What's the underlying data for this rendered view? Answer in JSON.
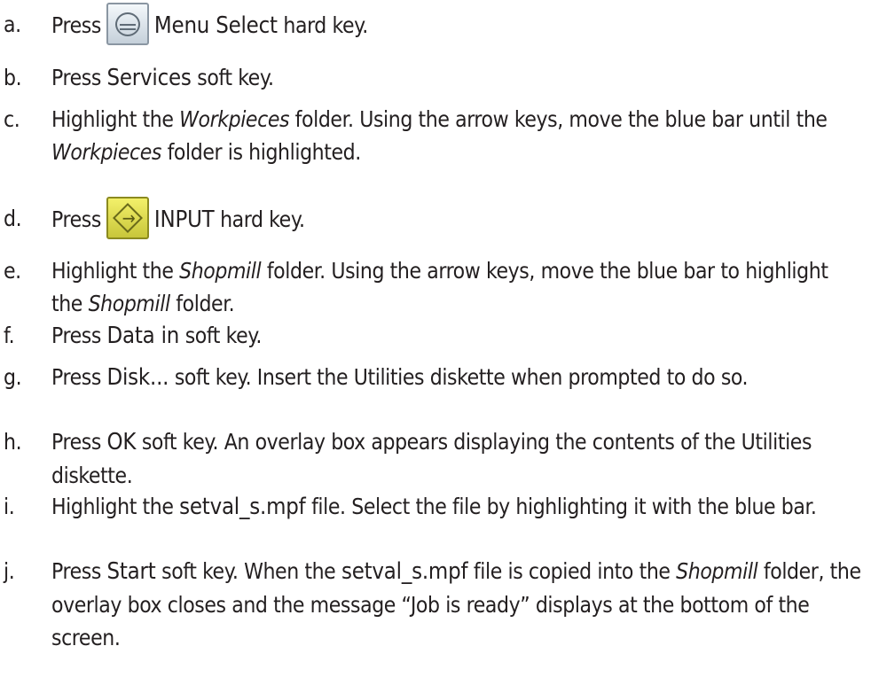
{
  "steps": [
    {
      "marker": "a.",
      "parts": [
        {
          "t": "Press"
        },
        {
          "key": "menu-select",
          "icon": "menu-select-key-icon"
        },
        {
          "t": "Menu Select",
          "s": "kw"
        },
        {
          "t": " hard key."
        }
      ]
    },
    {
      "marker": "b.",
      "parts": [
        {
          "t": "Press "
        },
        {
          "t": "Services",
          "s": "kw"
        },
        {
          "t": " soft key."
        }
      ]
    },
    {
      "marker": "c.",
      "parts": [
        {
          "t": "Highlight the "
        },
        {
          "t": "Workpieces",
          "s": "it"
        },
        {
          "t": " folder. Using the arrow keys, move the blue bar until the "
        },
        {
          "t": "Workpieces",
          "s": "it"
        },
        {
          "t": " folder is highlighted."
        }
      ]
    },
    {
      "marker": "d.",
      "parts": [
        {
          "t": "Press"
        },
        {
          "key": "input",
          "icon": "input-key-icon"
        },
        {
          "t": "INPUT",
          "s": "kw"
        },
        {
          "t": " hard key."
        }
      ]
    },
    {
      "marker": "e.",
      "parts": [
        {
          "t": "Highlight the "
        },
        {
          "t": "Shopmill",
          "s": "it"
        },
        {
          "t": " folder. Using the arrow keys, move the blue bar to highlight the "
        },
        {
          "t": "Shopmill",
          "s": "it"
        },
        {
          "t": " folder."
        }
      ]
    },
    {
      "marker": "f.",
      "parts": [
        {
          "t": "Press "
        },
        {
          "t": "Data in",
          "s": "kw"
        },
        {
          "t": " soft key."
        }
      ]
    },
    {
      "marker": "g.",
      "parts": [
        {
          "t": "Press "
        },
        {
          "t": "Disk...",
          "s": "kw"
        },
        {
          "t": " soft key. Insert the Utilities diskette when prompted to do so."
        }
      ]
    },
    {
      "marker": "h.",
      "parts": [
        {
          "t": "Press "
        },
        {
          "t": "OK",
          "s": "kw"
        },
        {
          "t": " soft key. An overlay box appears displaying the contents of the Utilities diskette."
        }
      ]
    },
    {
      "marker": "i.",
      "parts": [
        {
          "t": "Highlight the "
        },
        {
          "t": "setval_s.mpf",
          "s": "kw"
        },
        {
          "t": " file. Select the file by highlighting it with the blue bar."
        }
      ]
    },
    {
      "marker": "j.",
      "parts": [
        {
          "t": "Press "
        },
        {
          "t": "Start",
          "s": "kw"
        },
        {
          "t": " soft key. When the "
        },
        {
          "t": "setval_s.mpf",
          "s": "kw"
        },
        {
          "t": " file is copied into the "
        },
        {
          "t": "Shopmill",
          "s": "it"
        },
        {
          "t": " folder, the overlay box closes and the message “Job is ready” displays at the bottom of the screen."
        }
      ]
    }
  ]
}
